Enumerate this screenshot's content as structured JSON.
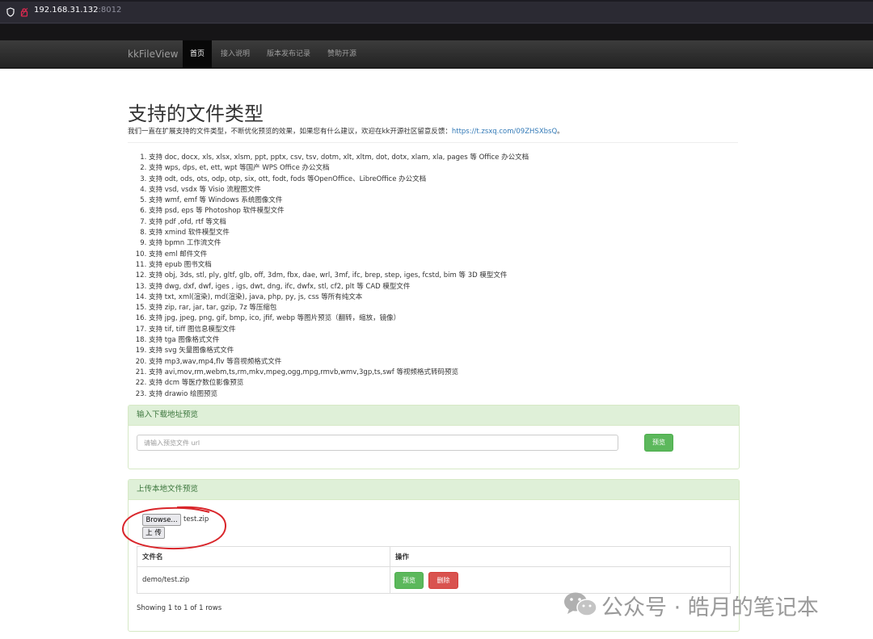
{
  "browser": {
    "url_host": "192.168.31.132",
    "url_port": ":8012"
  },
  "navbar": {
    "brand": "kkFileView",
    "items": [
      "首页",
      "接入说明",
      "版本发布记录",
      "赞助开源"
    ],
    "active_index": 0
  },
  "main": {
    "title": "支持的文件类型",
    "lead_text": "我们一直在扩展支持的文件类型，不断优化预览的效果，如果您有什么建议，欢迎在kk开源社区留意反馈：",
    "lead_link": "https://t.zsxq.com/09ZHSXbsQ",
    "lead_end": "。",
    "file_types": [
      "支持 doc, docx, xls, xlsx, xlsm, ppt, pptx, csv, tsv, dotm, xlt, xltm, dot, dotx, xlam, xla, pages 等 Office 办公文档",
      "支持 wps, dps, et, ett, wpt 等国产 WPS Office 办公文档",
      "支持 odt, ods, ots, odp, otp, six, ott, fodt, fods 等OpenOffice、LibreOffice 办公文档",
      "支持 vsd, vsdx 等 Visio 流程图文件",
      "支持 wmf, emf 等 Windows 系统图像文件",
      "支持 psd, eps 等 Photoshop 软件模型文件",
      "支持 pdf ,ofd, rtf 等文档",
      "支持 xmind 软件模型文件",
      "支持 bpmn 工作流文件",
      "支持 eml 邮件文件",
      "支持 epub 图书文档",
      "支持 obj, 3ds, stl, ply, gltf, glb, off, 3dm, fbx, dae, wrl, 3mf, ifc, brep, step, iges, fcstd, bim 等 3D 模型文件",
      "支持 dwg, dxf, dwf, iges , igs, dwt, dng, ifc, dwfx, stl, cf2, plt 等 CAD 模型文件",
      "支持 txt, xml(渲染), md(渲染), java, php, py, js, css 等所有纯文本",
      "支持 zip, rar, jar, tar, gzip, 7z 等压缩包",
      "支持 jpg, jpeg, png, gif, bmp, ico, jfif, webp 等图片预览（翻转，缩放，镜像）",
      "支持 tif, tiff 图信息模型文件",
      "支持 tga 图像格式文件",
      "支持 svg 矢量图像格式文件",
      "支持 mp3,wav,mp4,flv 等音视频格式文件",
      "支持 avi,mov,rm,webm,ts,rm,mkv,mpeg,ogg,mpg,rmvb,wmv,3gp,ts,swf 等视频格式转码预览",
      "支持 dcm 等医疗数位影像预览",
      "支持 drawio 绘图预览"
    ]
  },
  "url_panel": {
    "heading": "输入下载地址预览",
    "placeholder": "请输入预览文件 url",
    "button": "预览"
  },
  "upload_panel": {
    "heading": "上传本地文件预览",
    "browse_button": "Browse...",
    "selected_file": "test.zip",
    "upload_button": "上 传",
    "columns": [
      "文件名",
      "操作"
    ],
    "rows": [
      {
        "filename": "demo/test.zip",
        "preview": "预览",
        "delete": "删除"
      }
    ],
    "footer": "Showing 1 to 1 of 1 rows"
  },
  "annotation_color": "#d9262b",
  "watermark": {
    "text": "公众号 · 皓月的笔记本",
    "icon": "wechat-icon"
  }
}
